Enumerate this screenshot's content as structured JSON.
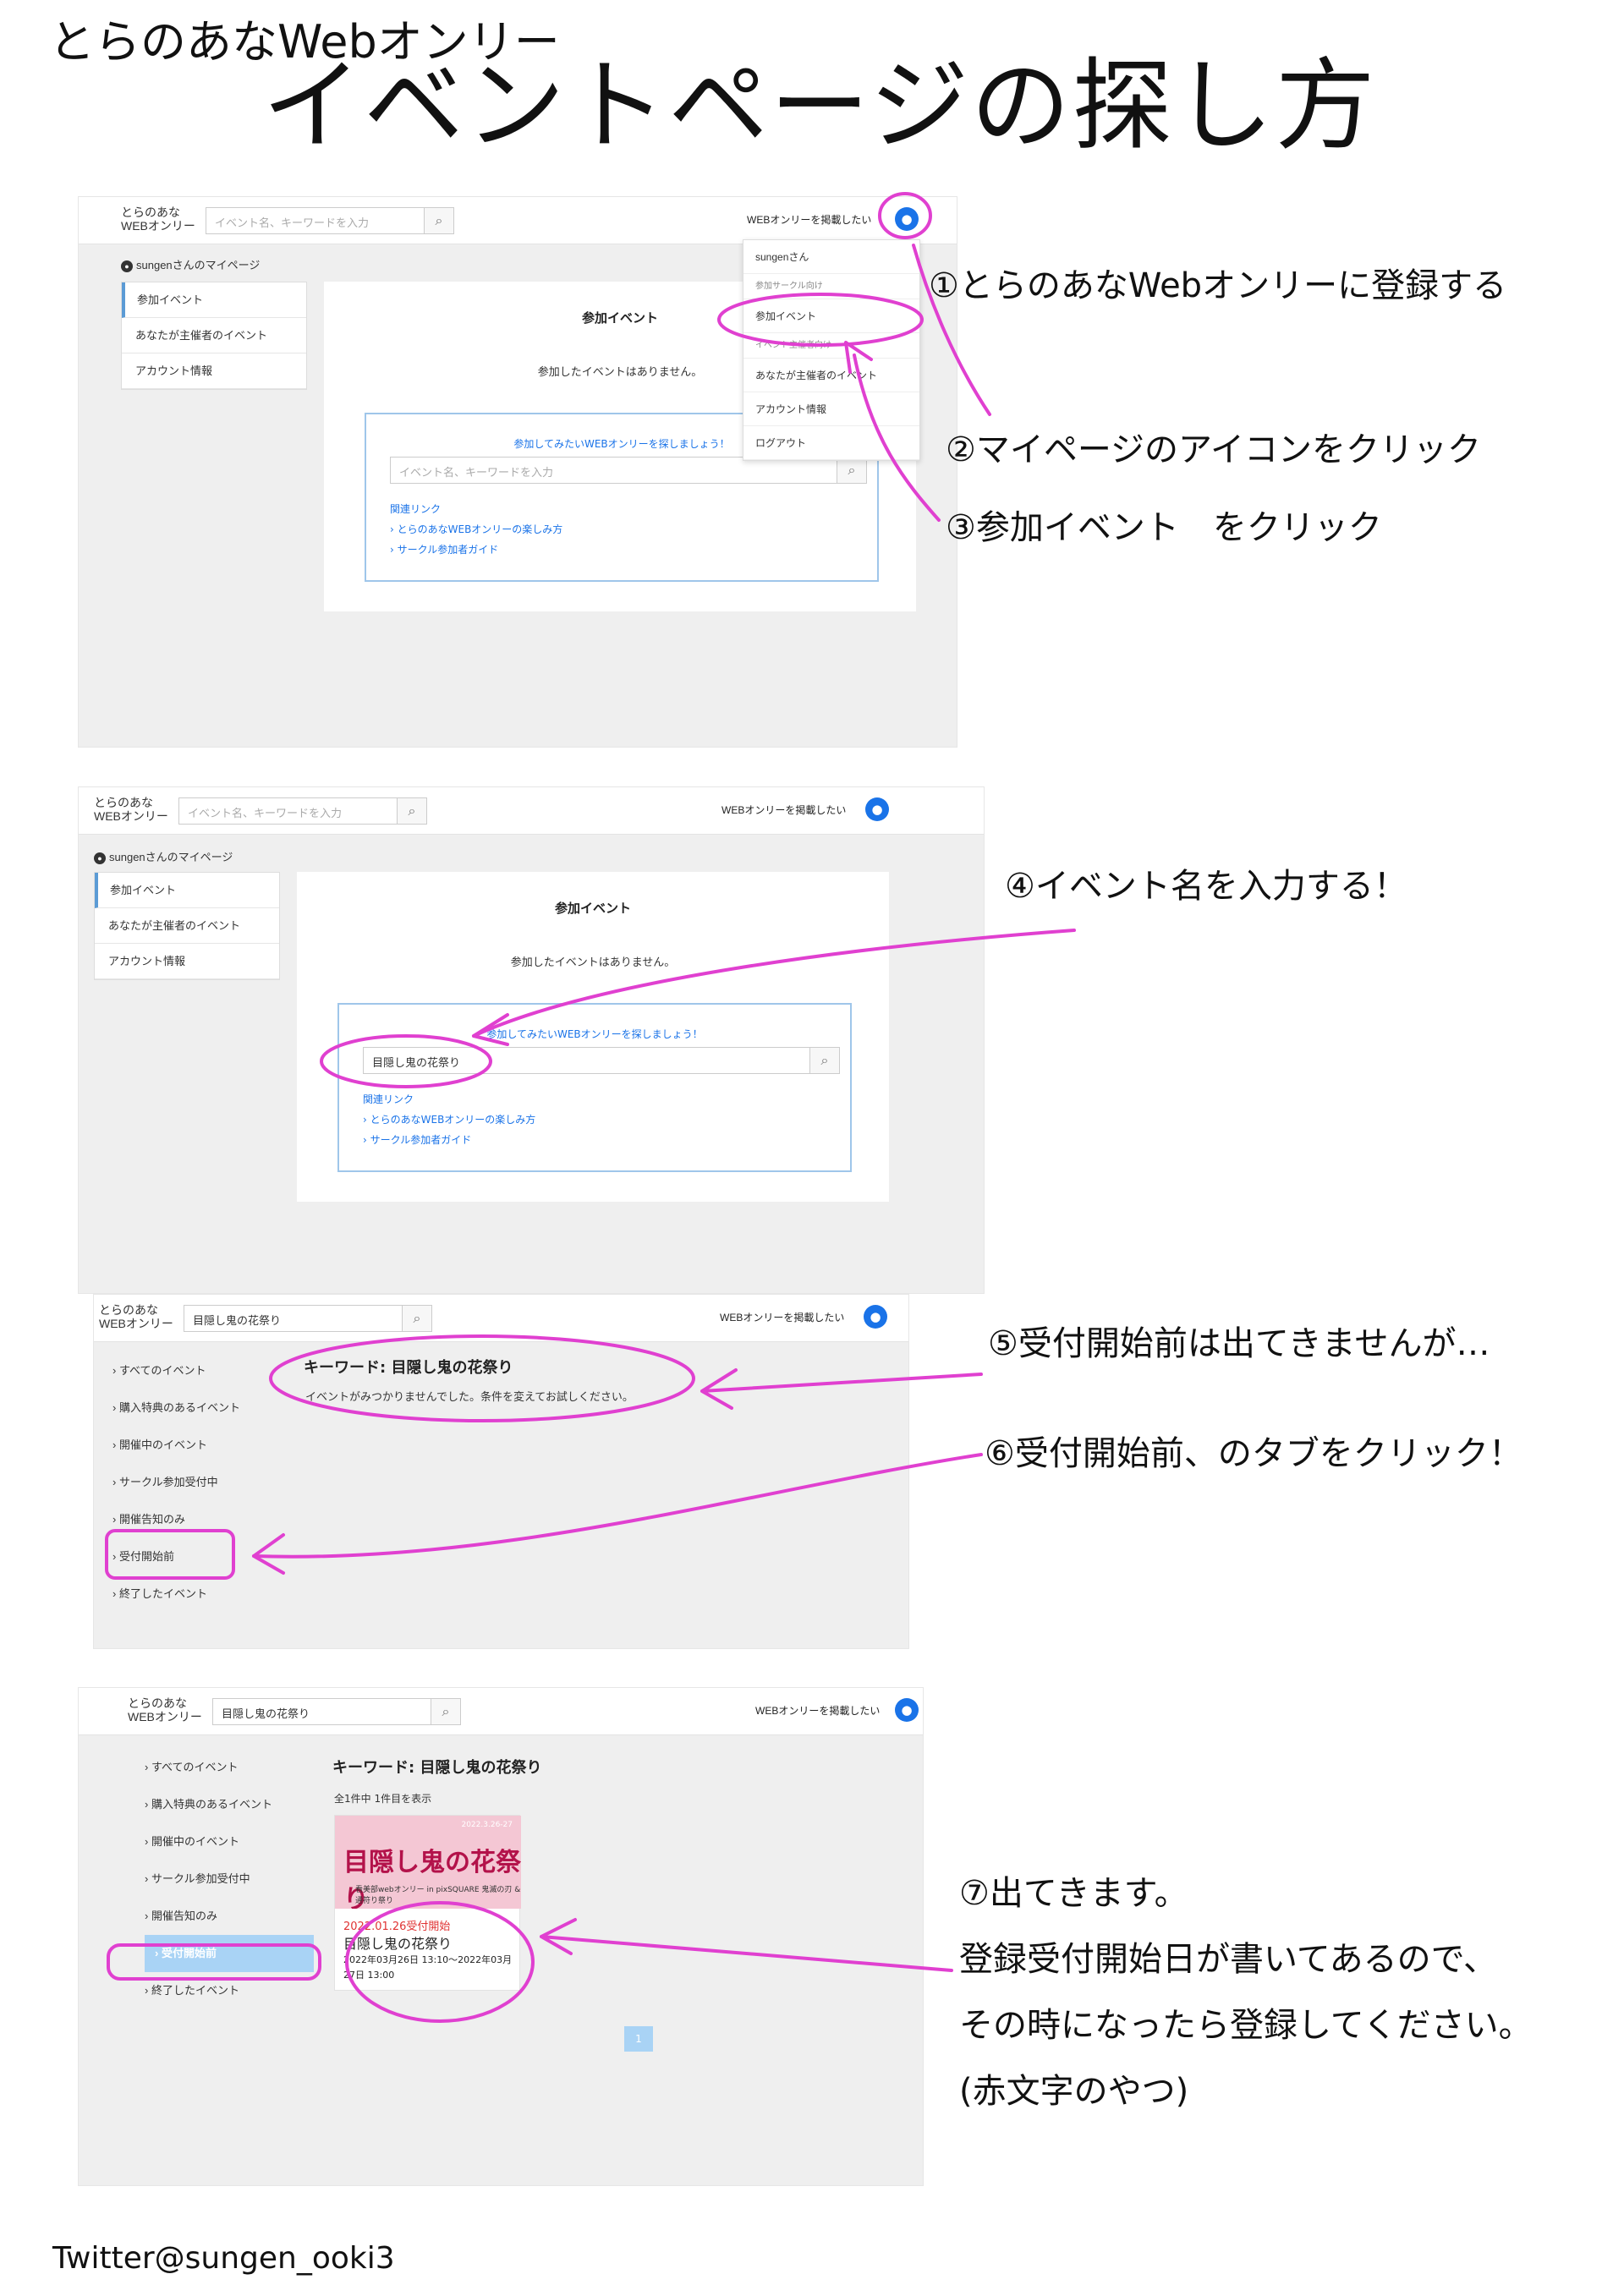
{
  "header": {
    "subtitle": "とらのあなWebオンリー",
    "title": "イベントページの探し方"
  },
  "footer": "Twitter@sungen_ooki3",
  "colors": {
    "annotation": "#e040d0",
    "accent": "#1a73e8",
    "selected_tab": "#a9d3f5",
    "register_date": "#e03333"
  },
  "common": {
    "logo_line1": "とらのあな",
    "logo_line2": "WEBオンリー",
    "search_placeholder": "イベント名、キーワードを入力",
    "post_link": "WEBオンリーを掲載したい",
    "search_icon": "search-icon",
    "user_icon": "user-icon"
  },
  "mypage": {
    "heading": "sungenさんのマイページ",
    "side": [
      "参加イベント",
      "あなたが主催者のイベント",
      "アカウント情報"
    ],
    "card_title": "参加イベント",
    "card_empty": "参加したイベントはありません。",
    "prompt": "参加してみたいWEBオンリーを探しましょう！",
    "related_title": "関連リンク",
    "related": [
      "とらのあなWEBオンリーの楽しみ方",
      "サークル参加者ガイド"
    ]
  },
  "dropdown": {
    "user": "sungenさん",
    "items": [
      "参加サークル向け",
      "参加イベント",
      "イベント主催者向け",
      "あなたが主催者のイベント",
      "アカウント情報",
      "ログアウト"
    ]
  },
  "search_value": "目隠し鬼の花祭り",
  "results": {
    "tabs": [
      "すべてのイベント",
      "購入特典のあるイベント",
      "開催中のイベント",
      "サークル参加受付中",
      "開催告知のみ",
      "受付開始前",
      "終了したイベント"
    ],
    "keyword": "キーワード: 目隠し鬼の花祭り",
    "not_found": "イベントがみつかりませんでした。条件を変えてお試しください。",
    "count": "全1件中 1件目を表示",
    "event": {
      "image_title": "目隠し鬼の花祭り",
      "image_sub": "看美部webオンリー in pixSQUARE 鬼滅の刃 & 通符り祭り",
      "image_date": "2022.3.26-27",
      "register_date": "2022.01.26受付開始",
      "name": "目隠し鬼の花祭り",
      "period": "2022年03月26日 13:10〜2022年03月27日 13:00"
    },
    "page": "1"
  },
  "annotations": [
    "①とらのあなWebオンリーに登録する",
    "②マイページのアイコンをクリック",
    "③参加イベント　をクリック",
    "④イベント名を入力する！",
    "⑤受付開始前は出てきませんが…",
    "⑥受付開始前、のタブをクリック！",
    "⑦出てきます。",
    "登録受付開始日が書いてあるので、",
    "その時になったら登録してください。",
    "(赤文字のやつ)"
  ]
}
